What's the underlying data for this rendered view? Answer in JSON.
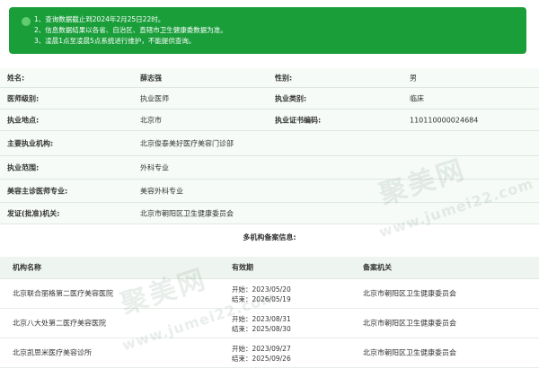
{
  "notice": {
    "lines": [
      "1、查询数据截止到2024年2月25日22时。",
      "2、信息数据结果以各省、自治区、直辖市卫生健康委数据为准。",
      "3、凌晨1点至凌晨5点系统进行维护，不能提供查询。"
    ]
  },
  "info": {
    "name_label": "姓名:",
    "name_value": "薛志强",
    "gender_label": "性别:",
    "gender_value": "男",
    "level_label": "医师级别:",
    "level_value": "执业医师",
    "category_label": "执业类别:",
    "category_value": "临床",
    "location_label": "执业地点:",
    "location_value": "北京市",
    "cert_label": "执业证书编码:",
    "cert_value": "110110000024684",
    "org_label": "主要执业机构:",
    "org_value": "北京俊泰美好医疗美容门诊部",
    "scope_label": "执业范围:",
    "scope_value": "外科专业",
    "cosmetic_label": "美容主诊医师专业:",
    "cosmetic_value": "美容外科专业",
    "issuer_label": "发证(批准)机关:",
    "issuer_value": "北京市朝阳区卫生健康委员会"
  },
  "multi": {
    "title": "多机构备案信息:",
    "headers": [
      "机构名称",
      "有效期",
      "备案机关"
    ],
    "rows": [
      {
        "name": "北京联合丽格第二医疗美容医院",
        "start": "开始：2023/05/20",
        "end": "结束：2026/05/19",
        "org": "北京市朝阳区卫生健康委员会"
      },
      {
        "name": "北京八大处第二医疗美容医院",
        "start": "开始：2023/08/31",
        "end": "结束：2025/08/30",
        "org": "北京市朝阳区卫生健康委员会"
      },
      {
        "name": "北京凯思米医疗美容诊所",
        "start": "开始：2023/09/27",
        "end": "结束：2025/09/26",
        "org": "北京市朝阳区卫生健康委员会"
      }
    ]
  },
  "watermark": {
    "text_big": "聚美网",
    "text_small": "www.jumei22.com"
  },
  "colors": {
    "notice_bg": "#1a9e3a",
    "row_bg": "#f6fbf7",
    "header_bg": "#eef5f0"
  }
}
